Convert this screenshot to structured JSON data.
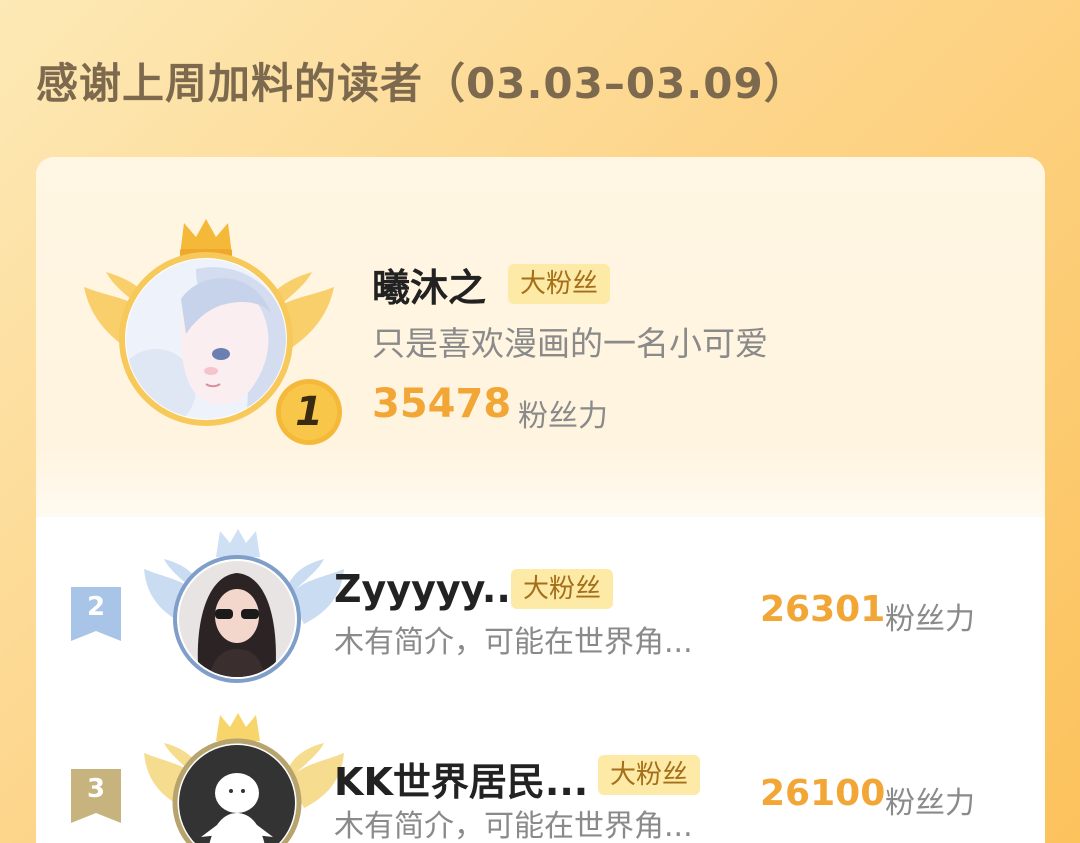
{
  "header": {
    "title": "感谢上周加料的读者（03.03–03.09）"
  },
  "colors": {
    "accent": "#f2a636",
    "badge_bg": "#fdeaa7",
    "badge_text": "#a56f1a",
    "gold": "#f5b93a",
    "silver": "#a8c4e6",
    "bronze": "#c7b37e"
  },
  "ranking": [
    {
      "rank": "1",
      "name": "曦沐之",
      "badge": "大粉丝",
      "bio": "只是喜欢漫画的一名小可爱",
      "score": "35478",
      "score_unit": "粉丝力",
      "avatar_icon": "anime-girl-avatar"
    },
    {
      "rank": "2",
      "name": "Zyyyyy...",
      "badge": "大粉丝",
      "bio": "木有简介，可能在世界角...",
      "score": "26301",
      "score_unit": "粉丝力",
      "avatar_icon": "girl-sunglasses-avatar"
    },
    {
      "rank": "3",
      "name": "KK世界居民...",
      "badge": "大粉丝",
      "bio": "木有简介，可能在世界角...",
      "score": "26100",
      "score_unit": "粉丝力",
      "avatar_icon": "default-ghost-avatar"
    }
  ]
}
